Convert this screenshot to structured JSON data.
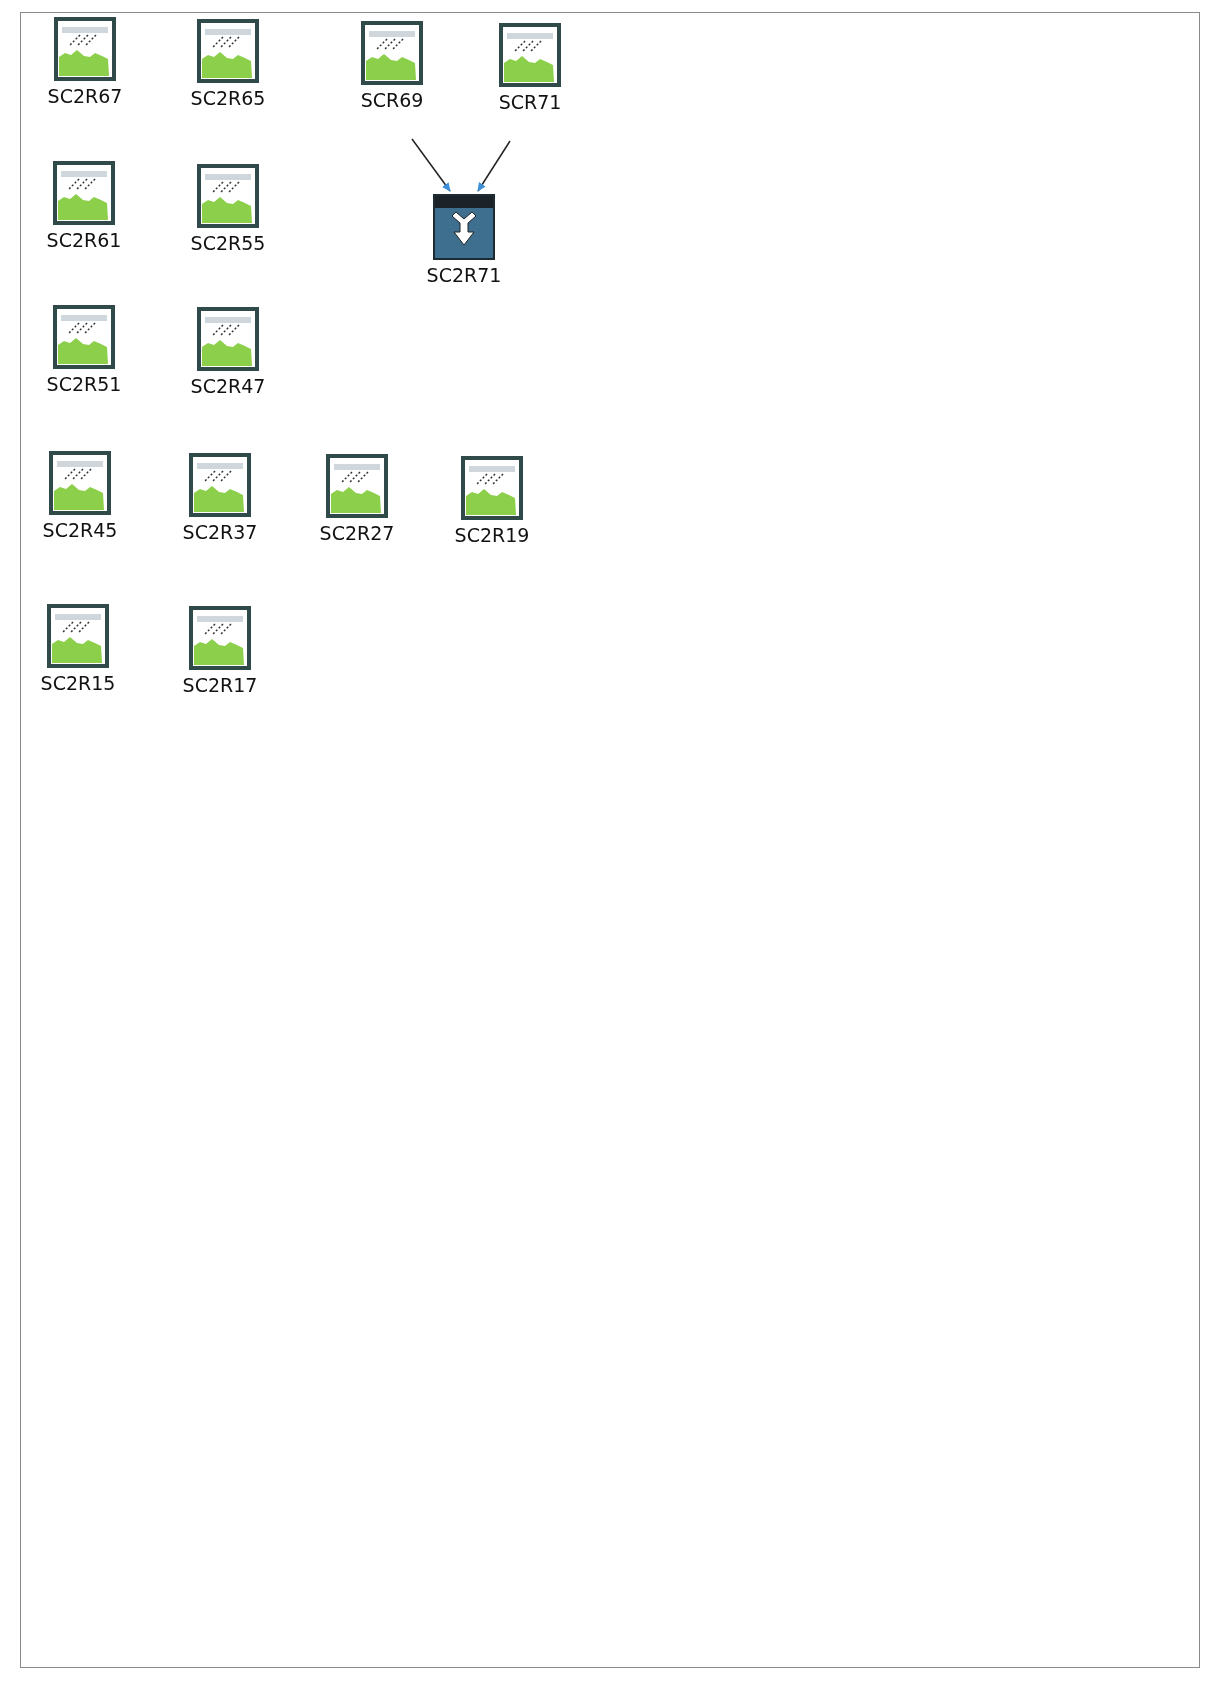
{
  "nodes": [
    {
      "kind": "raster",
      "label": "SC2R67"
    },
    {
      "kind": "raster",
      "label": "SC2R65"
    },
    {
      "kind": "raster",
      "label": "SCR69"
    },
    {
      "kind": "raster",
      "label": "SCR71"
    },
    {
      "kind": "raster",
      "label": "SC2R61"
    },
    {
      "kind": "raster",
      "label": "SC2R55"
    },
    {
      "kind": "tool",
      "label": "SC2R71"
    },
    {
      "kind": "raster",
      "label": "SC2R51"
    },
    {
      "kind": "raster",
      "label": "SC2R47"
    },
    {
      "kind": "raster",
      "label": "SC2R45"
    },
    {
      "kind": "raster",
      "label": "SC2R37"
    },
    {
      "kind": "raster",
      "label": "SC2R27"
    },
    {
      "kind": "raster",
      "label": "SC2R19"
    },
    {
      "kind": "raster",
      "label": "SC2R15"
    },
    {
      "kind": "raster",
      "label": "SC2R17"
    }
  ],
  "connectors": [
    {
      "kind": "arrow"
    },
    {
      "kind": "arrow"
    }
  ]
}
